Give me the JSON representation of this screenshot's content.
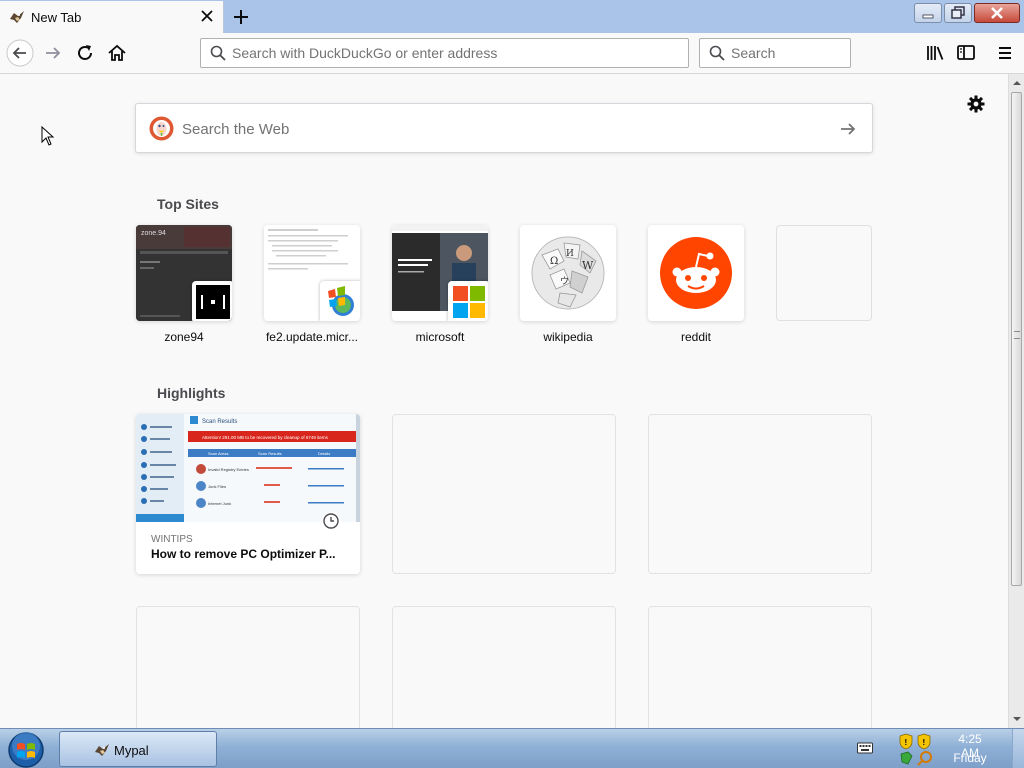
{
  "browser": {
    "tab": {
      "title": "New Tab",
      "favicon": "mypal-icon"
    },
    "new_tab_icon": "plus-icon",
    "window_controls": [
      "minimize-icon",
      "restore-icon",
      "close-icon"
    ],
    "nav": {
      "back_icon": "back-arrow-icon",
      "forward_icon": "forward-arrow-icon",
      "reload_icon": "reload-icon",
      "home_icon": "home-icon"
    },
    "urlbar": {
      "placeholder": "Search with DuckDuckGo or enter address",
      "value": ""
    },
    "searchbar": {
      "placeholder": "Search",
      "value": ""
    },
    "toolbar_icons": [
      "library-icon",
      "sidebar-icon",
      "hamburger-menu-icon"
    ]
  },
  "newtab": {
    "settings_icon": "gear-icon",
    "web_search": {
      "placeholder": "Search the Web",
      "engine_icon": "duckduckgo-logo",
      "submit_icon": "arrow-right-icon"
    },
    "top_sites_title": "Top Sites",
    "top_sites": [
      {
        "label": "zone94",
        "icon": "zone94-icon"
      },
      {
        "label": "fe2.update.micr...",
        "icon": "windows-update-icon"
      },
      {
        "label": "microsoft",
        "icon": "microsoft-logo"
      },
      {
        "label": "wikipedia",
        "icon": "wikipedia-globe-logo"
      },
      {
        "label": "reddit",
        "icon": "reddit-logo"
      },
      {
        "label": "",
        "icon": ""
      }
    ],
    "highlights_title": "Highlights",
    "highlights": [
      {
        "source": "WINTIPS",
        "title": "How to remove PC Optimizer P...",
        "icon": "clock-icon",
        "preview": {
          "header": "Scan Results",
          "alert": "Attention! 291.00 MB to be recovered by cleanup of 6749 items",
          "columns": [
            "Scan Areas",
            "Scan Results",
            "Details"
          ],
          "rows": [
            "Invalid Registry Entries",
            "Junk Files",
            "Internet Junk"
          ]
        }
      }
    ]
  },
  "taskbar": {
    "start_icon": "windows-start-orb",
    "items": [
      {
        "label": "Mypal",
        "icon": "mypal-icon"
      }
    ],
    "tray_icons": [
      "keyboard-icon",
      "security-shield-icon"
    ],
    "clock": {
      "time": "4:25 AM",
      "day": "Friday"
    }
  },
  "colors": {
    "accent": "#0060df",
    "reddit": "#ff4500",
    "titlebar": "#a9c3e9"
  }
}
